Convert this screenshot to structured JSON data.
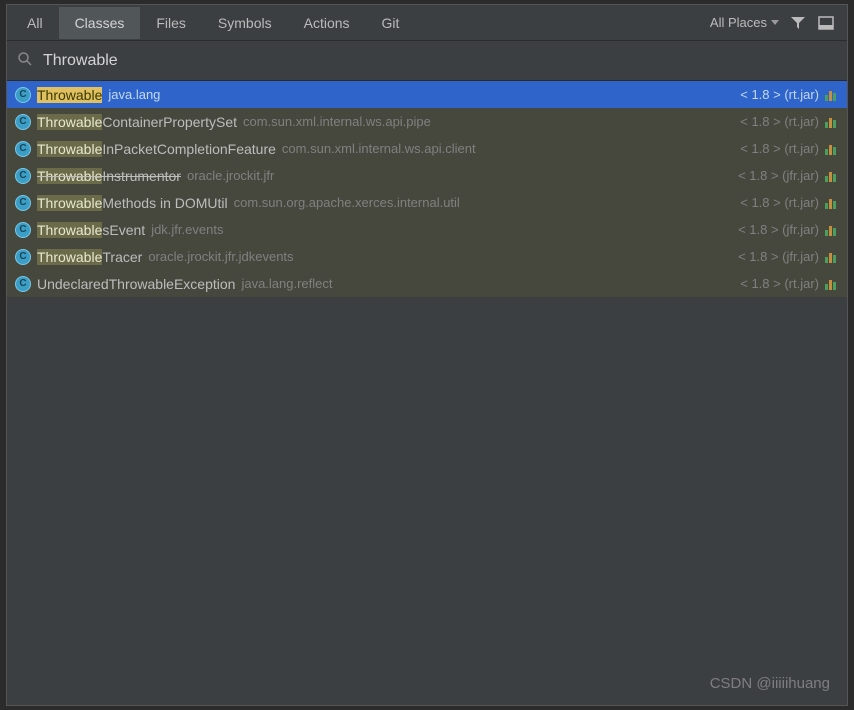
{
  "tabs": {
    "all": "All",
    "classes": "Classes",
    "files": "Files",
    "symbols": "Symbols",
    "actions": "Actions",
    "git": "Git"
  },
  "scope": {
    "prefix": "All ",
    "underlined": "P",
    "suffix": "laces"
  },
  "search": {
    "value": "Throwable"
  },
  "results": [
    {
      "highlight": "Throwable",
      "rest": "",
      "pkg": "java.lang",
      "meta": "< 1.8 > (rt.jar)",
      "selected": true,
      "strike": false
    },
    {
      "highlight": "Throwable",
      "rest": "ContainerPropertySet",
      "pkg": "com.sun.xml.internal.ws.api.pipe",
      "meta": "< 1.8 > (rt.jar)",
      "selected": false,
      "strike": false
    },
    {
      "highlight": "Throwable",
      "rest": "InPacketCompletionFeature",
      "pkg": "com.sun.xml.internal.ws.api.client",
      "meta": "< 1.8 > (rt.jar)",
      "selected": false,
      "strike": false
    },
    {
      "highlight": "Throwable",
      "rest": "Instrumentor",
      "pkg": "oracle.jrockit.jfr",
      "meta": "< 1.8 > (jfr.jar)",
      "selected": false,
      "strike": true
    },
    {
      "highlight": "Throwable",
      "rest": "Methods in DOMUtil",
      "pkg": "com.sun.org.apache.xerces.internal.util",
      "meta": "< 1.8 > (rt.jar)",
      "selected": false,
      "strike": false
    },
    {
      "highlight": "Throwable",
      "rest": "sEvent",
      "pkg": "jdk.jfr.events",
      "meta": "< 1.8 > (jfr.jar)",
      "selected": false,
      "strike": false
    },
    {
      "highlight": "Throwable",
      "rest": "Tracer",
      "pkg": "oracle.jrockit.jfr.jdkevents",
      "meta": "< 1.8 > (jfr.jar)",
      "selected": false,
      "strike": false
    },
    {
      "highlight": "",
      "rest": "UndeclaredThrowableException",
      "pkg": "java.lang.reflect",
      "meta": "< 1.8 > (rt.jar)",
      "selected": false,
      "strike": false
    }
  ],
  "watermark": "CSDN @iiiiihuang"
}
